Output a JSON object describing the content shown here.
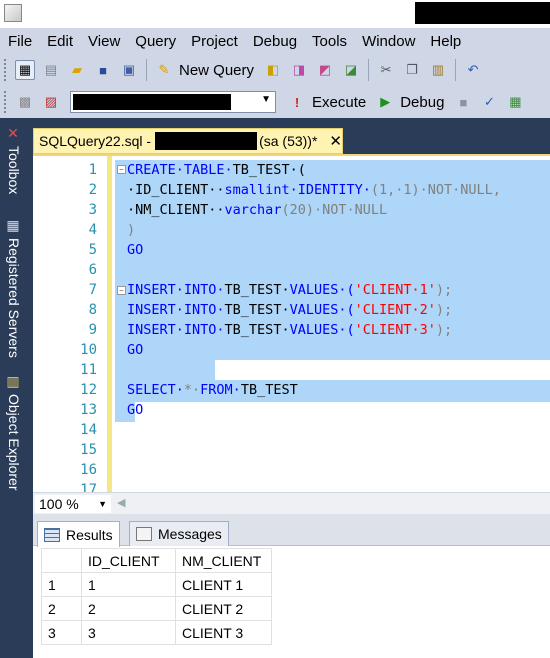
{
  "menu": [
    "File",
    "Edit",
    "View",
    "Query",
    "Project",
    "Debug",
    "Tools",
    "Window",
    "Help"
  ],
  "toolbar": {
    "new_query_label": "New Query",
    "execute_label": "Execute",
    "debug_label": "Debug"
  },
  "left_dock": {
    "toolbox": "Toolbox",
    "registered_servers": "Registered Servers",
    "object_explorer": "Object Explorer"
  },
  "document_tab": {
    "name": "SQLQuery22.sql -",
    "suffix": "(sa (53))*",
    "close": "✕"
  },
  "editor": {
    "line_numbers": [
      "1",
      "2",
      "3",
      "4",
      "5",
      "6",
      "7",
      "8",
      "9",
      "10",
      "11",
      "12",
      "13",
      "14",
      "15",
      "16",
      "17"
    ],
    "lines": {
      "l1_kw": "CREATE·TABLE·",
      "l1_rest": "TB_TEST·(",
      "l2_a": "·ID_CLIENT··",
      "l2_b": "smallint",
      "l2_c": "·IDENTITY·",
      "l2_d": "(1,·1)·NOT·NULL,",
      "l3_a": "·NM_CLIENT··",
      "l3_b": "varchar",
      "l3_c": "(20)·NOT·NULL",
      "l4": ")",
      "l5": "GO",
      "l7_kw": "INSERT·INTO·",
      "l7_tb": "TB_TEST·",
      "l7_vals": "VALUES·(",
      "l7_str": "'CLIENT·1'",
      "l7_end": ");",
      "l8_str": "'CLIENT·2'",
      "l9_str": "'CLIENT·3'",
      "l10": "GO",
      "l12_kw": "SELECT·",
      "l12_star": "*·",
      "l12_from": "FROM·",
      "l12_tb": "TB_TEST",
      "l13": "GO"
    }
  },
  "zoom": "100 %",
  "results": {
    "tabs": [
      "Results",
      "Messages"
    ],
    "columns": [
      "ID_CLIENT",
      "NM_CLIENT"
    ],
    "rows": [
      {
        "n": "1",
        "id": "1",
        "name": "CLIENT 1"
      },
      {
        "n": "2",
        "id": "2",
        "name": "CLIENT 2"
      },
      {
        "n": "3",
        "id": "3",
        "name": "CLIENT 3"
      }
    ]
  }
}
